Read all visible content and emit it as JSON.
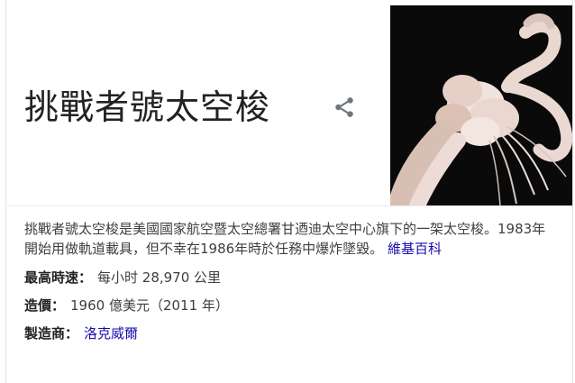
{
  "panel": {
    "title": "挑戰者號太空梭",
    "share_icon": "share-icon",
    "image_alt": "challenger-explosion-photo"
  },
  "description": {
    "text": "挑戰者號太空梭是美國國家航空暨太空總署甘迺迪太空中心旗下的一架太空梭。1983年開始用做軌道載具，但不幸在1986年時於任務中爆炸墜毀。",
    "source_link": "維基百科"
  },
  "facts": [
    {
      "key": "最高時速：",
      "value": "每小时 28,970 公里",
      "is_link": false
    },
    {
      "key": "造價：",
      "value": "1960 億美元（2011 年）",
      "is_link": false
    },
    {
      "key": "製造商：",
      "value": "洛克威爾",
      "is_link": true
    }
  ],
  "colors": {
    "link": "#1a0dab",
    "text": "#3c4043",
    "title": "#222222",
    "icon": "#70757a"
  }
}
